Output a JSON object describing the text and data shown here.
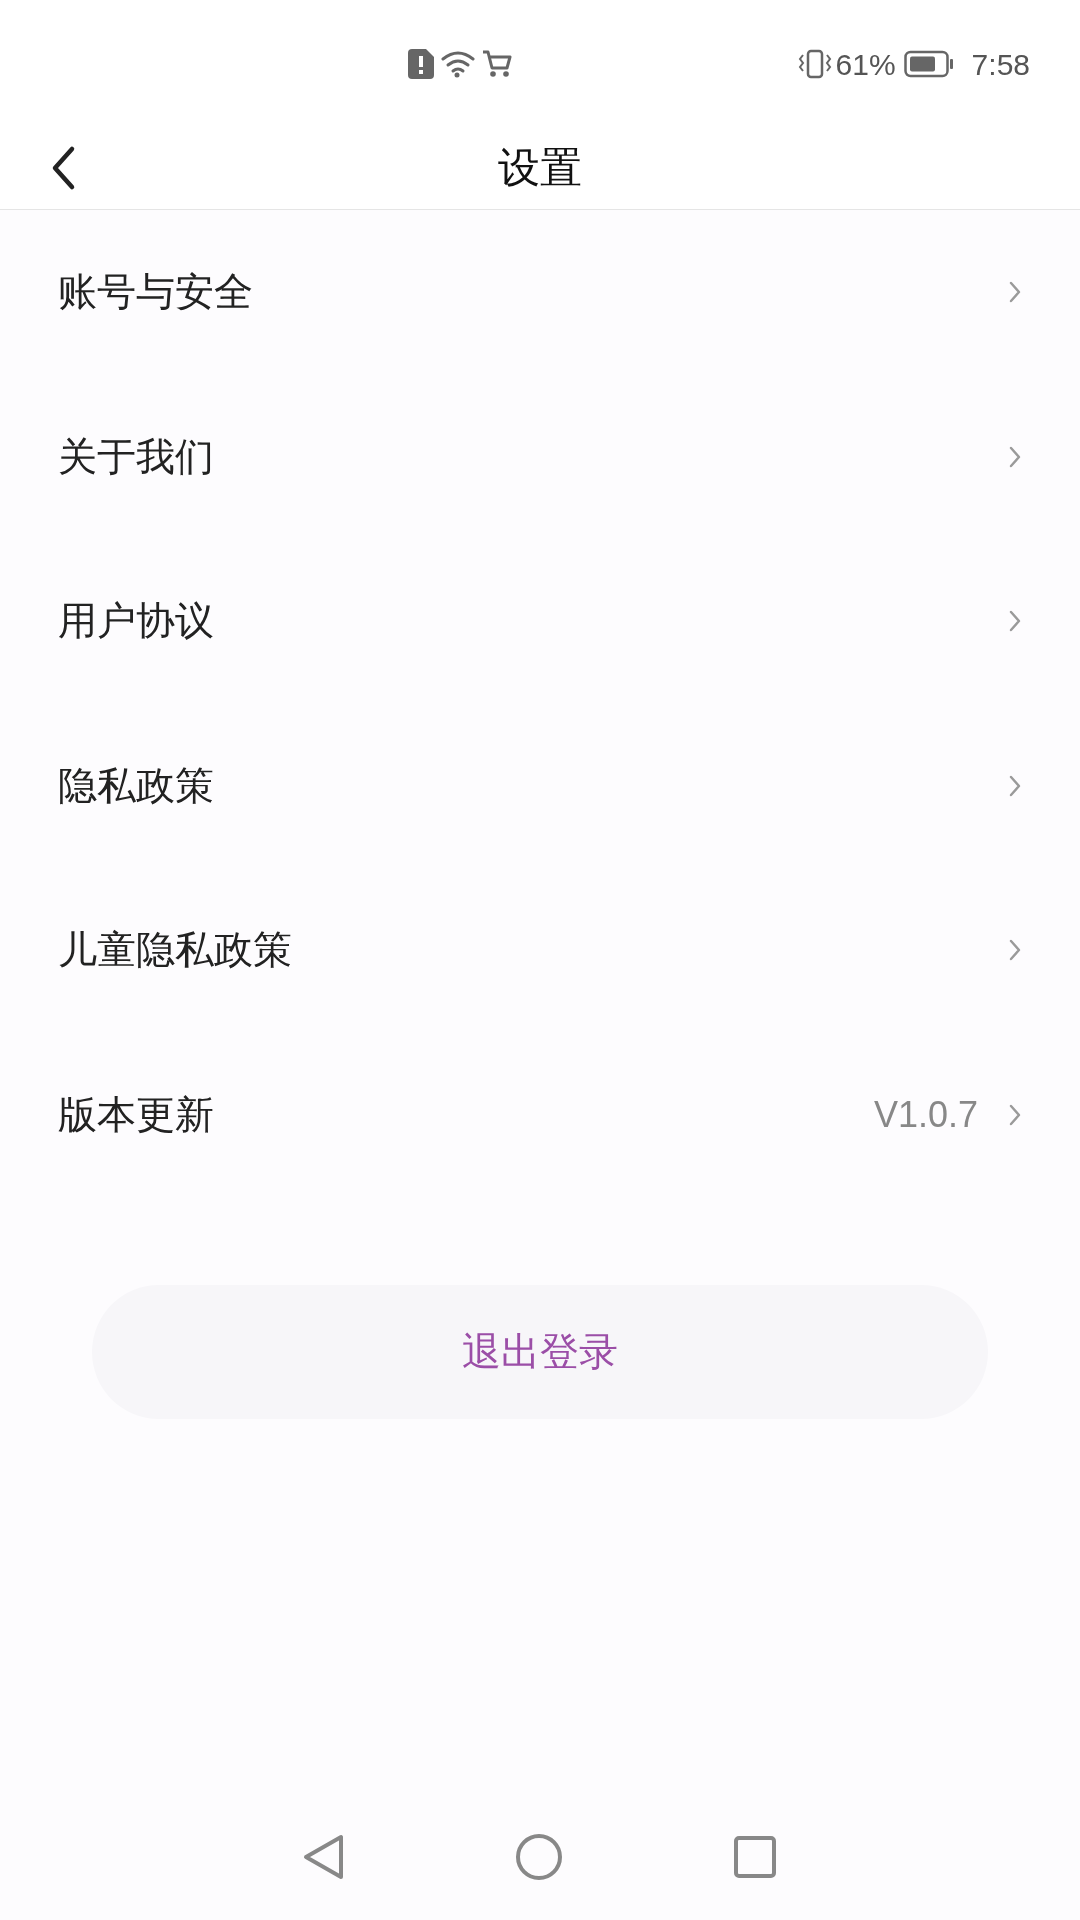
{
  "status_bar": {
    "battery": "61%",
    "time": "7:58"
  },
  "header": {
    "title": "设置"
  },
  "menu": [
    {
      "label": "账号与安全"
    },
    {
      "label": "关于我们"
    },
    {
      "label": "用户协议"
    },
    {
      "label": "隐私政策"
    },
    {
      "label": "儿童隐私政策"
    },
    {
      "label": "版本更新",
      "value": "V1.0.7"
    }
  ],
  "logout_button": "退出登录"
}
